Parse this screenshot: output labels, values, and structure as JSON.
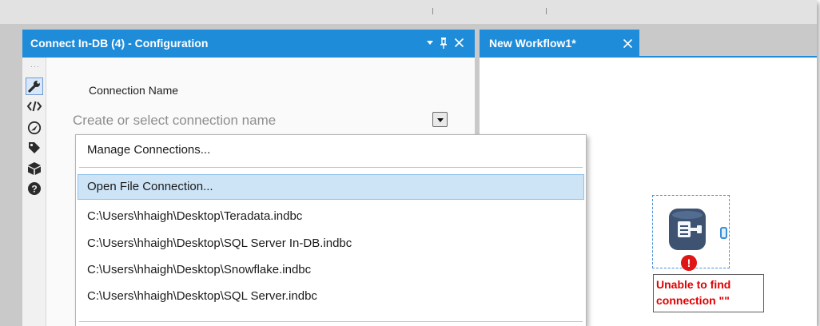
{
  "config_panel": {
    "title": "Connect In-DB (4) - Configuration",
    "header_buttons": [
      "dropdown-arrow",
      "pin",
      "close"
    ],
    "icons": [
      "wrench-icon",
      "code-icon",
      "navigate-icon",
      "tag-icon",
      "package-icon",
      "help-icon"
    ],
    "connection_name_label": "Connection Name",
    "connection_input": {
      "value": "",
      "placeholder": "Create or select connection name"
    }
  },
  "dropdown": {
    "items": [
      "Manage Connections...",
      "Open File Connection...",
      "C:\\Users\\hhaigh\\Desktop\\Teradata.indbc",
      "C:\\Users\\hhaigh\\Desktop\\SQL Server In-DB.indbc",
      "C:\\Users\\hhaigh\\Desktop\\Snowflake.indbc",
      "C:\\Users\\hhaigh\\Desktop\\SQL Server.indbc"
    ],
    "highlighted_index": 1
  },
  "workflow": {
    "tab_title": "New Workflow1*",
    "error_line1": "Unable to find",
    "error_line2": "connection \"\"",
    "error_badge": "!"
  },
  "colors": {
    "accent": "#1f8cd9",
    "highlight": "#cde4f7",
    "error": "#e00000"
  }
}
